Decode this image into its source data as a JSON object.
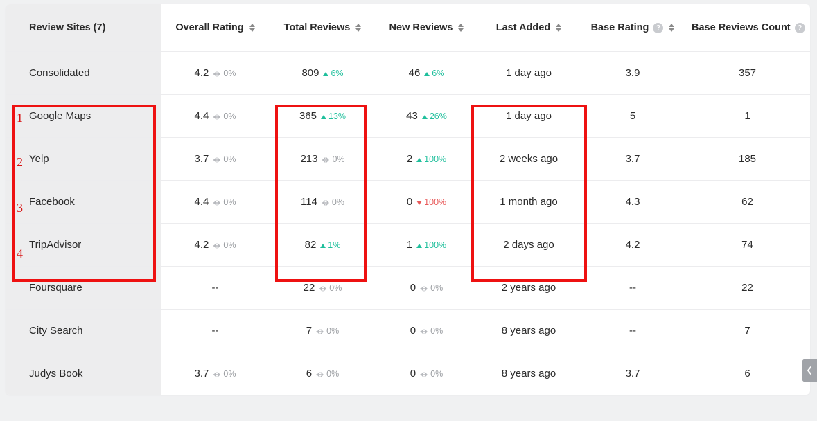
{
  "headers": {
    "site": "Review Sites (7)",
    "overall": "Overall Rating",
    "total": "Total Reviews",
    "new": "New Reviews",
    "last": "Last Added",
    "base": "Base Rating",
    "count": "Base Reviews Count"
  },
  "rows": [
    {
      "site": "Consolidated",
      "overall": {
        "value": "4.2",
        "delta": "0%",
        "dir": "flat"
      },
      "total": {
        "value": "809",
        "delta": "6%",
        "dir": "up"
      },
      "new": {
        "value": "46",
        "delta": "6%",
        "dir": "up"
      },
      "last": "1 day ago",
      "base": "3.9",
      "count": "357"
    },
    {
      "site": "Google Maps",
      "overall": {
        "value": "4.4",
        "delta": "0%",
        "dir": "flat"
      },
      "total": {
        "value": "365",
        "delta": "13%",
        "dir": "up"
      },
      "new": {
        "value": "43",
        "delta": "26%",
        "dir": "up"
      },
      "last": "1 day ago",
      "base": "5",
      "count": "1"
    },
    {
      "site": "Yelp",
      "overall": {
        "value": "3.7",
        "delta": "0%",
        "dir": "flat"
      },
      "total": {
        "value": "213",
        "delta": "0%",
        "dir": "flat"
      },
      "new": {
        "value": "2",
        "delta": "100%",
        "dir": "up"
      },
      "last": "2 weeks ago",
      "base": "3.7",
      "count": "185"
    },
    {
      "site": "Facebook",
      "overall": {
        "value": "4.4",
        "delta": "0%",
        "dir": "flat"
      },
      "total": {
        "value": "114",
        "delta": "0%",
        "dir": "flat"
      },
      "new": {
        "value": "0",
        "delta": "100%",
        "dir": "down"
      },
      "last": "1 month ago",
      "base": "4.3",
      "count": "62"
    },
    {
      "site": "TripAdvisor",
      "overall": {
        "value": "4.2",
        "delta": "0%",
        "dir": "flat"
      },
      "total": {
        "value": "82",
        "delta": "1%",
        "dir": "up"
      },
      "new": {
        "value": "1",
        "delta": "100%",
        "dir": "up"
      },
      "last": "2 days ago",
      "base": "4.2",
      "count": "74"
    },
    {
      "site": "Foursquare",
      "overall": {
        "value": "--",
        "delta": null,
        "dir": null
      },
      "total": {
        "value": "22",
        "delta": "0%",
        "dir": "flat"
      },
      "new": {
        "value": "0",
        "delta": "0%",
        "dir": "flat"
      },
      "last": "2 years ago",
      "base": "--",
      "count": "22"
    },
    {
      "site": "City Search",
      "overall": {
        "value": "--",
        "delta": null,
        "dir": null
      },
      "total": {
        "value": "7",
        "delta": "0%",
        "dir": "flat"
      },
      "new": {
        "value": "0",
        "delta": "0%",
        "dir": "flat"
      },
      "last": "8 years ago",
      "base": "--",
      "count": "7"
    },
    {
      "site": "Judys Book",
      "overall": {
        "value": "3.7",
        "delta": "0%",
        "dir": "flat"
      },
      "total": {
        "value": "6",
        "delta": "0%",
        "dir": "flat"
      },
      "new": {
        "value": "0",
        "delta": "0%",
        "dir": "flat"
      },
      "last": "8 years ago",
      "base": "3.7",
      "count": "6"
    }
  ],
  "annotations": {
    "numbers": [
      "1",
      "2",
      "3",
      "4"
    ]
  }
}
